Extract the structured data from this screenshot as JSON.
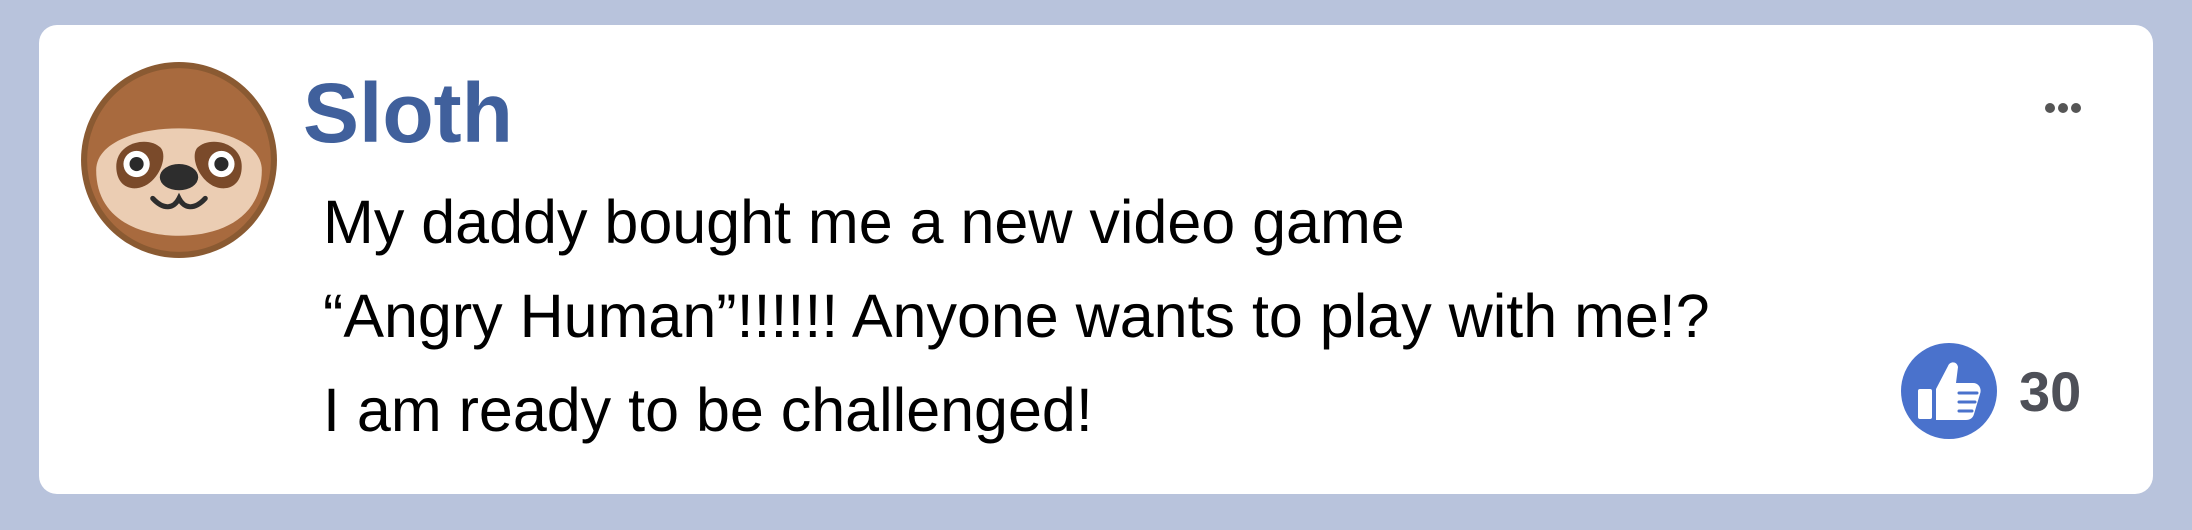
{
  "post": {
    "author": "Sloth",
    "lines": [
      "My daddy bought me a new video game",
      "“Angry Human”!!!!!! Anyone wants to play with me!?",
      "I am ready to be challenged!"
    ],
    "like_count": "30"
  },
  "icons": {
    "avatar": "sloth-face",
    "more": "ellipsis-horizontal",
    "like": "thumbs-up"
  },
  "colors": {
    "background": "#b8c3dc",
    "author_name": "#40609c",
    "like_badge": "#4a72cc",
    "like_count": "#4e5058"
  }
}
